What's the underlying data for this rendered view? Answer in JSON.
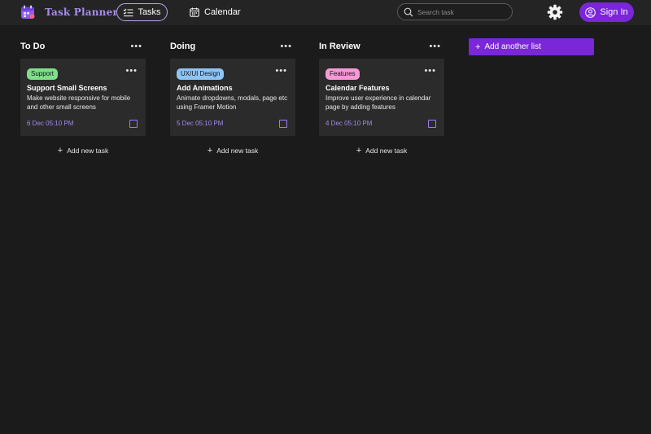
{
  "header": {
    "app_title": "Task Planner",
    "nav": {
      "tasks_label": "Tasks",
      "calendar_label": "Calendar"
    },
    "search": {
      "placeholder": "Search task",
      "value": ""
    },
    "signin_label": "Sign In"
  },
  "colors": {
    "accent": "#7a26d9",
    "brand_text": "#a88bf0",
    "badge_support": "#7ee08a",
    "badge_uiux": "#8ec5f5",
    "badge_features": "#f59ad6"
  },
  "icons": {
    "logo": "calendar-logo-icon",
    "tasks": "checklist-icon",
    "calendar": "calendar-icon",
    "search": "search-icon",
    "settings": "gear-icon",
    "user": "user-circle-icon",
    "more": "more-horizontal-icon",
    "add": "plus-icon"
  },
  "lists": [
    {
      "title": "To Do",
      "cards": [
        {
          "badge": "Support",
          "title": "Support Small Screens",
          "description": "Make website responsive for mobile and other small screens",
          "date": "6 Dec 05:10 PM"
        }
      ],
      "add_label": "Add new task"
    },
    {
      "title": "Doing",
      "cards": [
        {
          "badge": "UX/UI Design",
          "title": "Add Animations",
          "description": "Animate dropdowns, modals, page etc using Framer Motion",
          "date": "5 Dec 05:10 PM"
        }
      ],
      "add_label": "Add new task"
    },
    {
      "title": "In Review",
      "cards": [
        {
          "badge": "Features",
          "title": "Calendar Features",
          "description": "Improve user experience in calendar page by adding features",
          "date": "4 Dec 05:10 PM"
        }
      ],
      "add_label": "Add new task"
    }
  ],
  "add_list_label": "Add another list"
}
